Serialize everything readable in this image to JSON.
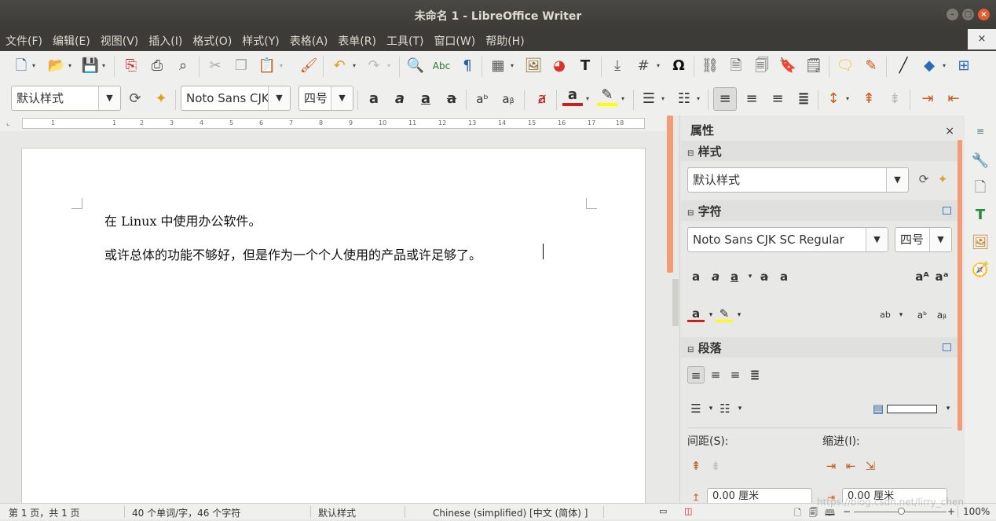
{
  "window": {
    "title": "未命名 1 - LibreOffice Writer"
  },
  "menu": {
    "items": [
      "文件(F)",
      "编辑(E)",
      "视图(V)",
      "插入(I)",
      "格式(O)",
      "样式(Y)",
      "表格(A)",
      "表单(R)",
      "工具(T)",
      "窗口(W)",
      "帮助(H)"
    ],
    "close": "×"
  },
  "formatting": {
    "paragraph_style": "默认样式",
    "font_name": "Noto Sans CJK",
    "font_size": "四号"
  },
  "document": {
    "paragraphs": [
      "在 Linux 中使用办公软件。",
      "或许总体的功能不够好，但是作为一个个人使用的产品或许足够了。"
    ]
  },
  "ruler": {
    "marks": [
      "1",
      "1",
      "2",
      "3",
      "4",
      "5",
      "6",
      "7",
      "8",
      "9",
      "10",
      "11",
      "12",
      "13",
      "14",
      "15",
      "16",
      "17",
      "18"
    ]
  },
  "sidebar": {
    "title": "属性",
    "close": "×",
    "styles_section": "样式",
    "style_value": "默认样式",
    "character_section": "字符",
    "font_value": "Noto Sans CJK SC Regular",
    "size_value": "四号",
    "paragraph_section": "段落",
    "spacing_label": "间距(S):",
    "indent_label": "缩进(I):",
    "spacing_value": "0.00 厘米",
    "indent_value": "0.00 厘米"
  },
  "status": {
    "page": "第 1 页，共 1 页",
    "words": "40 个单词/字，46 个字符",
    "style": "默认样式",
    "language": "Chinese (simplified) [中文 (简体) ]",
    "zoom": "100%"
  },
  "watermark": "https://blog.csdn.net/lirry_chen",
  "colors": {
    "titlebar": "#3c3b37",
    "accent": "#f39b77",
    "font_color_bar": "#c9211e",
    "highlight_bar": "#ffff00"
  }
}
